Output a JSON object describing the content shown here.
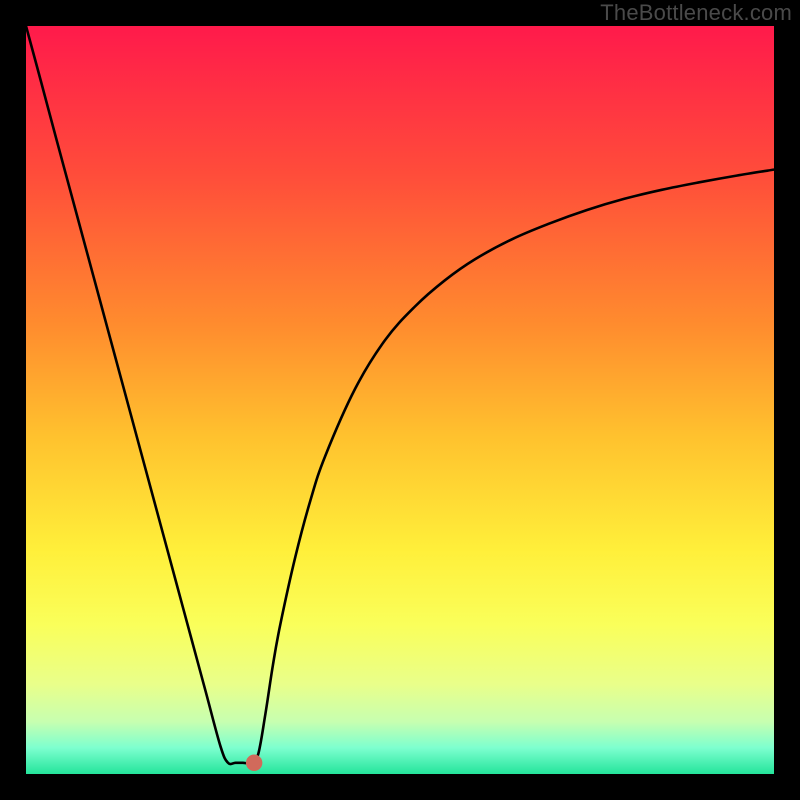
{
  "watermark": "TheBottleneck.com",
  "chart_data": {
    "type": "line",
    "title": "",
    "xlabel": "",
    "ylabel": "",
    "xlim": [
      0,
      100
    ],
    "ylim": [
      0,
      100
    ],
    "grid": false,
    "legend": false,
    "background_gradient": {
      "stops": [
        {
          "offset": 0.0,
          "color": "#ff1a4b"
        },
        {
          "offset": 0.2,
          "color": "#ff4d3a"
        },
        {
          "offset": 0.4,
          "color": "#ff8c2e"
        },
        {
          "offset": 0.55,
          "color": "#ffc22e"
        },
        {
          "offset": 0.7,
          "color": "#ffef3a"
        },
        {
          "offset": 0.8,
          "color": "#faff5a"
        },
        {
          "offset": 0.88,
          "color": "#e9ff8a"
        },
        {
          "offset": 0.93,
          "color": "#c7ffb0"
        },
        {
          "offset": 0.965,
          "color": "#7dffcf"
        },
        {
          "offset": 1.0,
          "color": "#24e59b"
        }
      ]
    },
    "series": [
      {
        "name": "bottleneck-curve",
        "x": [
          0,
          2,
          4,
          6,
          8,
          10,
          12,
          14,
          16,
          18,
          20,
          22,
          24,
          26,
          27,
          28,
          29,
          30,
          31,
          32,
          33,
          34,
          36,
          38,
          40,
          44,
          48,
          52,
          56,
          60,
          65,
          70,
          75,
          80,
          85,
          90,
          95,
          100
        ],
        "y": [
          100,
          92.6,
          85.1,
          77.7,
          70.3,
          62.9,
          55.5,
          48.1,
          40.7,
          33.3,
          25.9,
          18.5,
          11.1,
          3.7,
          1.5,
          1.5,
          1.5,
          1.5,
          2.5,
          8.0,
          14.5,
          20.0,
          29.0,
          36.5,
          42.5,
          51.5,
          58.0,
          62.5,
          66.0,
          68.8,
          71.5,
          73.6,
          75.4,
          76.9,
          78.1,
          79.1,
          80.0,
          80.8
        ]
      }
    ],
    "marker": {
      "x": 30.5,
      "y": 1.5,
      "color": "#d16a5b",
      "r": 1.1
    }
  }
}
